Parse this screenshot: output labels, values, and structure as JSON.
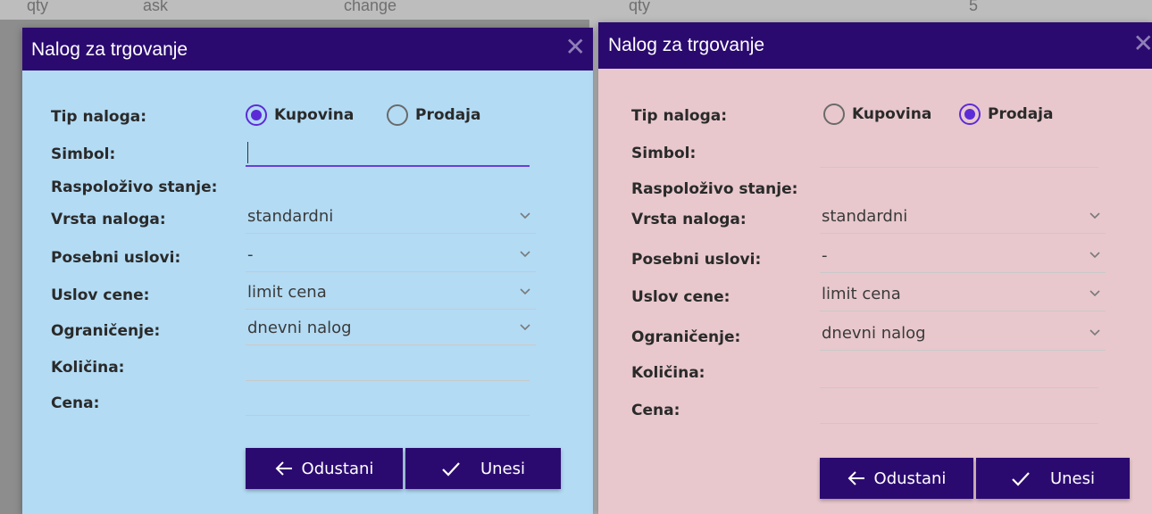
{
  "background": {
    "strip_left": [
      "qty",
      "ask",
      "change"
    ],
    "strip_right": [
      "qty",
      "5"
    ]
  },
  "dialogs": [
    {
      "title": "Nalog za trgovanje",
      "close_glyph": "✕",
      "labels": {
        "tip": "Tip naloga:",
        "simbol": "Simbol:",
        "stanje": "Raspoloživo stanje:",
        "vrsta": "Vrsta naloga:",
        "uslovi": "Posebni uslovi:",
        "cena_uslov": "Uslov cene:",
        "ogranicenje": "Ograničenje:",
        "kolicina": "Količina:",
        "cena": "Cena:"
      },
      "order_type": {
        "buy": "Kupovina",
        "sell": "Prodaja",
        "selected": "buy"
      },
      "symbol_value": "",
      "selects": {
        "vrsta": "standardni",
        "uslovi": "-",
        "cena_uslov": "limit cena",
        "ogranicenje": "dnevni nalog"
      },
      "buttons": {
        "cancel": "Odustani",
        "submit": "Unesi"
      },
      "colors": {
        "body": "#b3dbf4",
        "header": "#2b0a70"
      }
    },
    {
      "title": "Nalog za trgovanje",
      "close_glyph": "✕",
      "labels": {
        "tip": "Tip naloga:",
        "simbol": "Simbol:",
        "stanje": "Raspoloživo stanje:",
        "vrsta": "Vrsta naloga:",
        "uslovi": "Posebni uslovi:",
        "cena_uslov": "Uslov cene:",
        "ogranicenje": "Ograničenje:",
        "kolicina": "Količina:",
        "cena": "Cena:"
      },
      "order_type": {
        "buy": "Kupovina",
        "sell": "Prodaja",
        "selected": "sell"
      },
      "symbol_value": "",
      "selects": {
        "vrsta": "standardni",
        "uslovi": "-",
        "cena_uslov": "limit cena",
        "ogranicenje": "dnevni nalog"
      },
      "buttons": {
        "cancel": "Odustani",
        "submit": "Unesi"
      },
      "colors": {
        "body": "#e8c8cd",
        "header": "#2b0a70"
      }
    }
  ]
}
